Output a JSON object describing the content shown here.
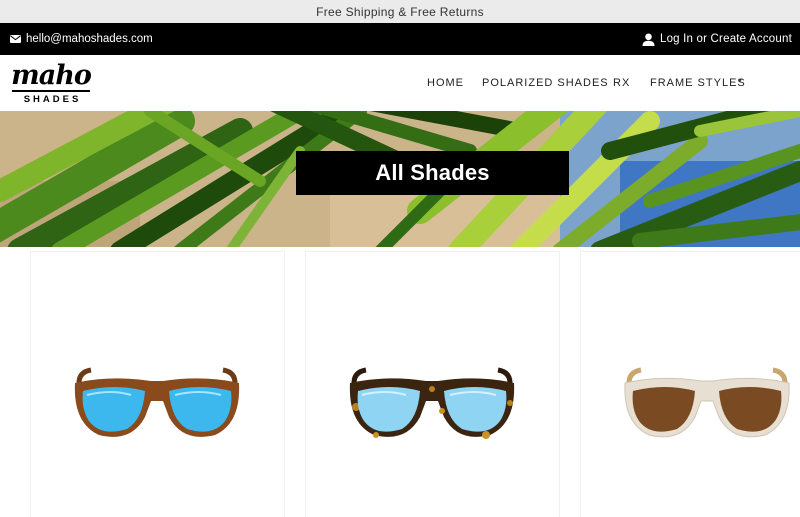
{
  "announcement": "Free Shipping & Free Returns",
  "topbar": {
    "email": "hello@mahoshades.com",
    "account_text": "Log In or Create Account"
  },
  "logo": {
    "word": "maho",
    "sub": "SHADES"
  },
  "nav": {
    "items": [
      {
        "label": "HOME"
      },
      {
        "label": "POLARIZED SHADES"
      },
      {
        "label": "RX"
      },
      {
        "label": "FRAME STYLES"
      }
    ]
  },
  "hero": {
    "title": "All Shades"
  },
  "products": [
    {
      "frame": "tortoise-amber",
      "frame_color": "#8a4a1c",
      "lens_color": "#3cb8ef"
    },
    {
      "frame": "tortoise-dark",
      "frame_color": "#3b2410",
      "lens_color": "#8fd4f2"
    },
    {
      "frame": "clear-crystal",
      "frame_color": "#e6dfd2",
      "lens_color": "#7a4a22"
    }
  ]
}
